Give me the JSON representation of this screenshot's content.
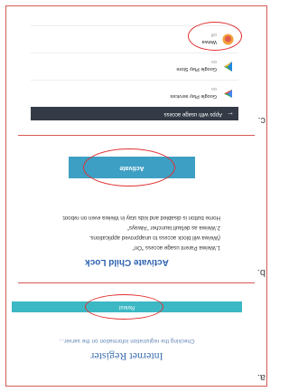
{
  "steps": {
    "a": {
      "letter": "a.",
      "title": "Internet Register",
      "status": "Checking the registration information on the server...",
      "button_label": "Retest"
    },
    "b": {
      "letter": "b.",
      "title": "Activate Child Lock",
      "items": [
        "1.Weiwa Parent usage access \"On\"",
        "(Weiwa will block access to unapproved applications.",
        "2.Weiwa as default launcher \"Always\"",
        "Home button is disabled and kids stay in Weiwa even on reboot."
      ],
      "button_label": "Activate"
    },
    "c": {
      "letter": "c.",
      "header_title": "Apps with usage access",
      "back_glyph": "←",
      "apps": [
        {
          "name": "Google Play services",
          "status": "On",
          "icon": "google-play-services-icon"
        },
        {
          "name": "Google Play Store",
          "status": "On",
          "icon": "google-play-store-icon"
        },
        {
          "name": "Weiwa",
          "status": "Off",
          "icon": "weiwa-app-icon"
        }
      ]
    }
  },
  "colors": {
    "frame": "#d55a55",
    "button_teal": "#3cb8c4",
    "button_blue": "#3e9fc4",
    "title_blue": "#2d62b0",
    "highlight_ellipse": "#e03030"
  }
}
